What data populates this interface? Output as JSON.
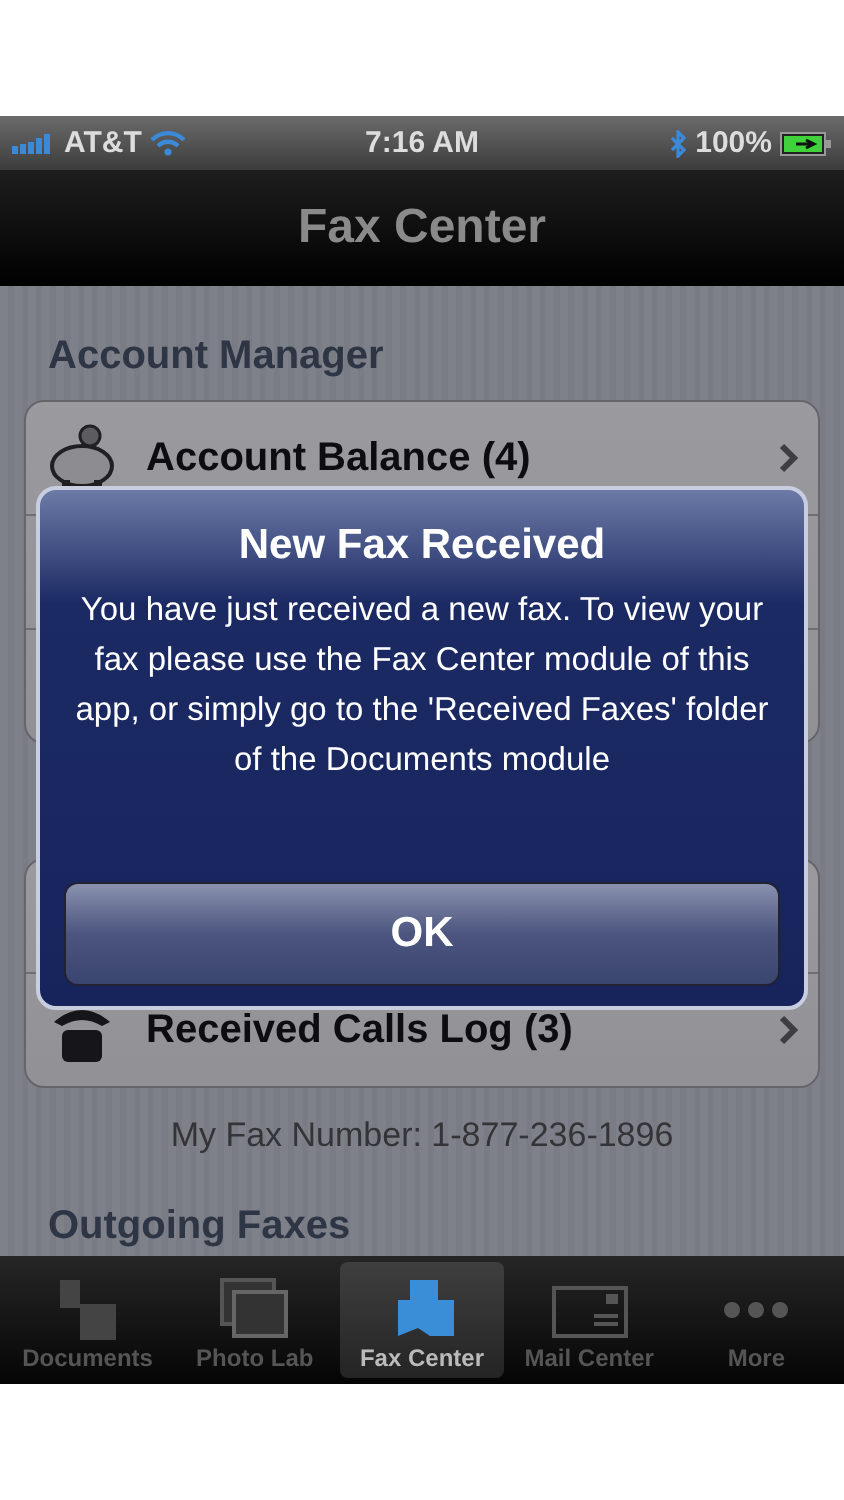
{
  "status_bar": {
    "carrier": "AT&T",
    "time": "7:16 AM",
    "battery": "100%"
  },
  "nav": {
    "title": "Fax Center"
  },
  "sections": [
    {
      "header": "Account Manager",
      "rows": [
        {
          "kind": "item",
          "label": "Account Balance (4)"
        },
        {
          "kind": "covered"
        },
        {
          "kind": "covered"
        }
      ]
    },
    {
      "rows": [
        {
          "kind": "covered"
        },
        {
          "kind": "item",
          "label": "Received Calls Log (3)"
        }
      ],
      "note": "My Fax Number: 1-877-236-1896"
    },
    {
      "header": "Outgoing Faxes"
    }
  ],
  "alert": {
    "title": "New Fax Received",
    "message": "You have just received a new fax. To view your fax please use the Fax Center module of this app, or simply go to the 'Received Faxes' folder of the Documents module",
    "button": "OK"
  },
  "tabs": [
    {
      "label": "Documents",
      "selected": false
    },
    {
      "label": "Photo Lab",
      "selected": false
    },
    {
      "label": "Fax Center",
      "selected": true
    },
    {
      "label": "Mail Center",
      "selected": false
    },
    {
      "label": "More",
      "selected": false
    }
  ]
}
